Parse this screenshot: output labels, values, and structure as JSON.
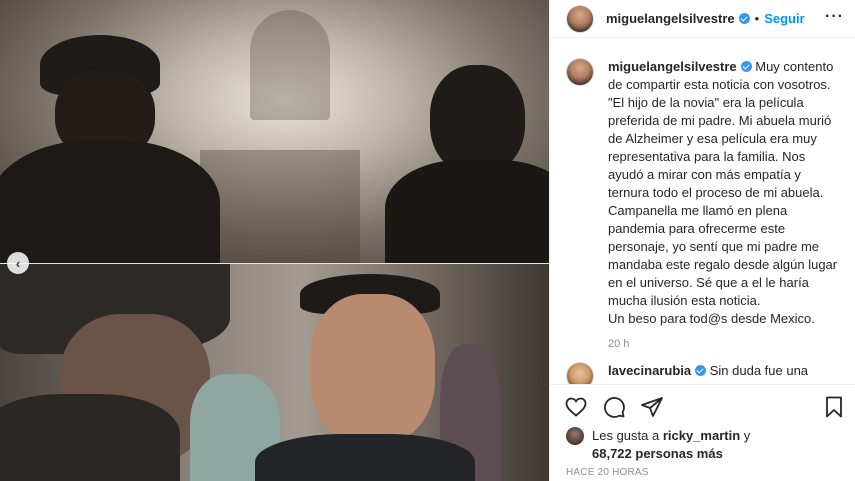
{
  "post": {
    "username": "miguelangelsilvestre",
    "follow_label": "Seguir",
    "separator": "•",
    "more_label": "···",
    "caption": "Muy contento de compartir esta noticia con vosotros. \"El hijo de la novia\" era la película preferida de mi padre. Mi abuela murió de Alzheimer y esa película era muy representativa para la familia. Nos ayudó a mirar con más empatía y ternura todo el proceso de mi abuela. Campanella me llamó en plena pandemia para ofrecerme este personaje, yo sentí que mi padre me mandaba este regalo desde algún lugar en el universo. Sé que a el le haría mucha ilusión esta noticia.\nUn beso para tod@s desde Mexico.",
    "caption_time": "20 h",
    "comment_username": "lavecinarubia",
    "comment_text": "Sin duda fue una",
    "likes_prefix": "Les gusta a",
    "likes_user": "ricky_martin",
    "likes_and": "y",
    "likes_count": "68,722 personas más",
    "posted_ago": "HACE 20 HORAS"
  },
  "colors": {
    "accent": "#0095f6",
    "verified": "#3897f0",
    "muted": "#8e8e8e"
  },
  "icons": [
    "heart-icon",
    "comment-icon",
    "share-icon",
    "bookmark-icon",
    "chevron-left-icon",
    "verified-icon"
  ]
}
